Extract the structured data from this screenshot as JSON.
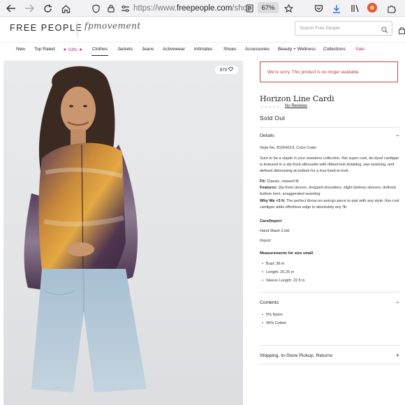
{
  "browser": {
    "url_prefix": "https://www.",
    "url_domain": "freepeople.com",
    "url_rest": "/shop",
    "zoom": "67%"
  },
  "site": {
    "logo": "FREE PEOPLE",
    "sub_brand": "fpmovement",
    "search_placeholder": "Search Free People"
  },
  "nav": {
    "items": [
      "New",
      "Top Rated",
      "★ Gifts ★",
      "Clothes",
      "Jackets",
      "Jeans",
      "Activewear",
      "Intimates",
      "Shoes",
      "Accessories",
      "Beauty + Wellness",
      "Collections",
      "Sale"
    ],
    "active": "Clothes"
  },
  "photo": {
    "like_count": "970"
  },
  "product": {
    "alert": "We're sorry. This product is no longer available.",
    "title": "Horizon Line Cardi",
    "reviews_label": "No Reviews",
    "rating": 0,
    "status": "Sold Out",
    "details": {
      "heading": "Details",
      "style_line": "Style No. 81564213; Color Code:",
      "description": "Sure to be a staple in your sweaters collection, this super cool, tie-dyed cardigan is featured in a zip-front silhouette with ribbed knit detailing, raw seaming, and defined distressing at bottom for a true lived-in look.",
      "fit_label": "Fit:",
      "fit_value": "Classic, relaxed fit",
      "features_label": "Features:",
      "features_value": "Zip-front closure, dropped shoulders, slight dolman sleeves, defined bottom hem, exaggerated seaming",
      "why_label": "Why We <3 It:",
      "why_value": "The perfect throw-on-and-go piece to pair with any style, this cool cardigan adds effortless edge to absolutely any 'fit.",
      "care_heading": "Care/Import",
      "care_1": "Hand Wash Cold",
      "care_2": "Import",
      "measure_heading": "Measurements for size small",
      "measurements": [
        "Bust: 36 in",
        "Length: 20.25 in",
        "Sleeve Length: 22.5 in"
      ]
    },
    "contents": {
      "heading": "Contents",
      "items": [
        "5% Nylon",
        "95% Cotton"
      ]
    },
    "shipping_heading": "Shipping, In-Store Pickup, Returns"
  },
  "colors": {
    "alert": "#c0392b",
    "gifts": "#b23a8e",
    "sale": "#c0305e"
  }
}
